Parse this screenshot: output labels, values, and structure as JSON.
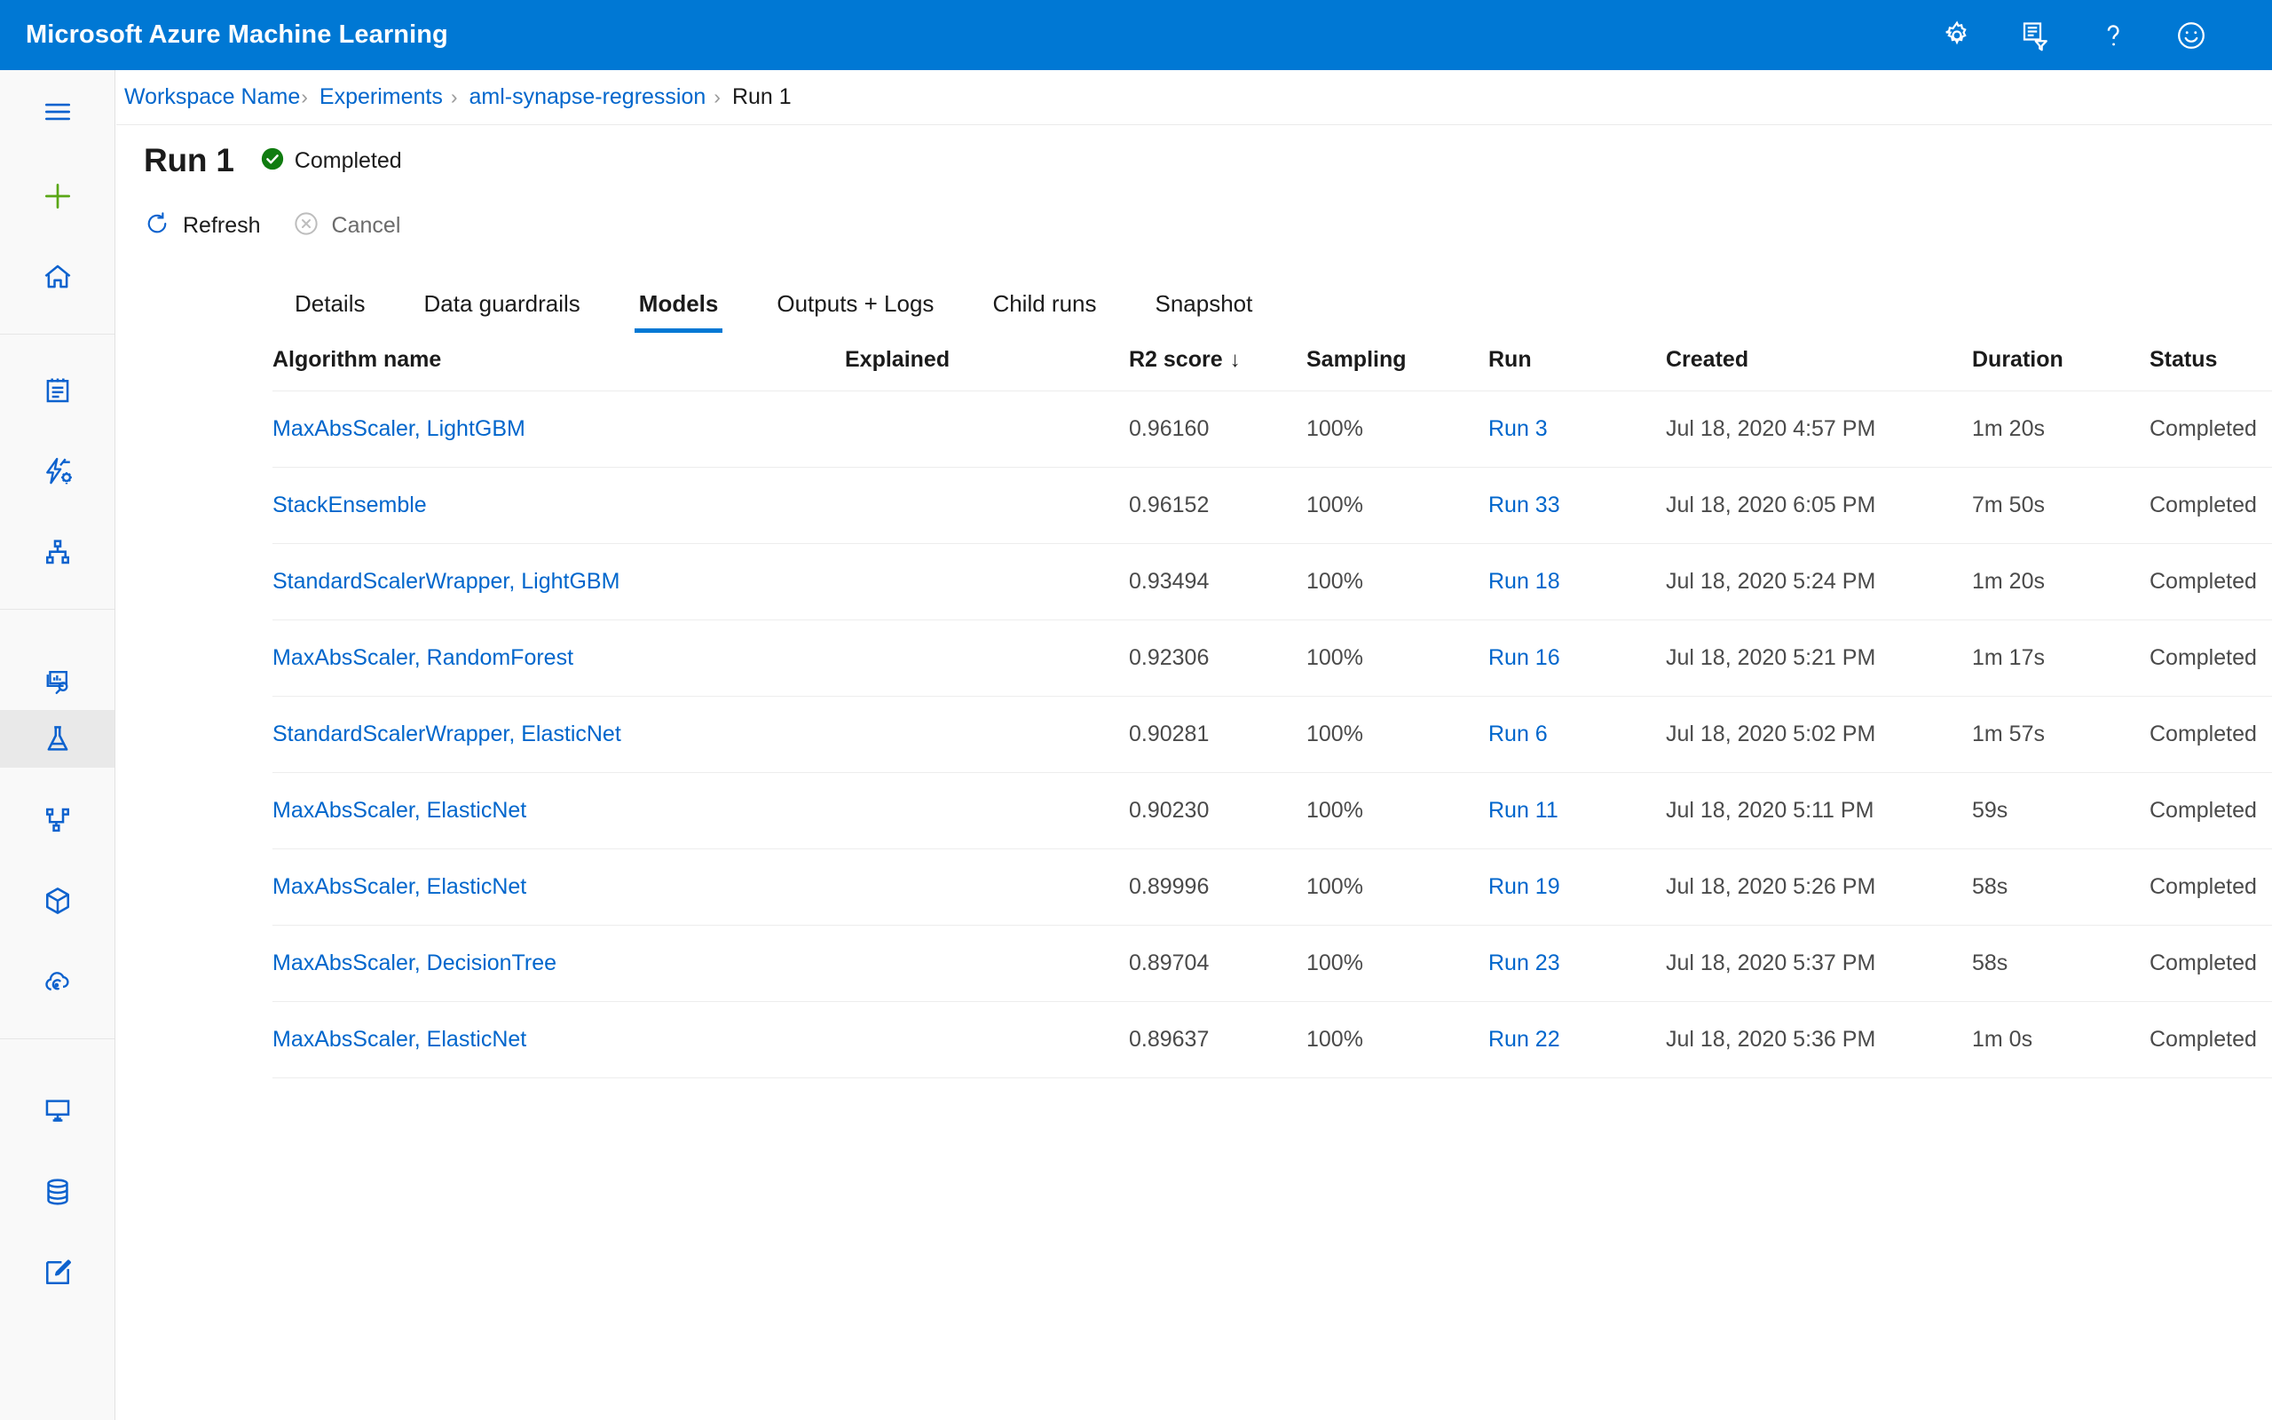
{
  "topbar": {
    "brand": "Microsoft Azure Machine Learning",
    "accent_color": "#0078d4",
    "icons": [
      {
        "name": "gear-icon",
        "label": "Settings"
      },
      {
        "name": "activity-log-icon",
        "label": "Activity log"
      },
      {
        "name": "help-icon",
        "label": "Help"
      },
      {
        "name": "feedback-smiley-icon",
        "label": "Feedback"
      }
    ]
  },
  "rail": {
    "items": [
      {
        "name": "hamburger-menu-icon",
        "label": "Menu",
        "active": false
      },
      {
        "name": "new-plus-icon",
        "label": "New",
        "active": false
      },
      {
        "name": "home-icon",
        "label": "Home",
        "active": false
      },
      {
        "name": "notebooks-icon",
        "label": "Notebooks",
        "active": false
      },
      {
        "name": "automated-ml-icon",
        "label": "Automated ML",
        "active": false
      },
      {
        "name": "designer-icon",
        "label": "Designer",
        "active": false
      },
      {
        "name": "datasets-explore-icon",
        "label": "Datasets",
        "active": false
      },
      {
        "name": "experiments-flask-icon",
        "label": "Experiments",
        "active": true
      },
      {
        "name": "pipelines-icon",
        "label": "Pipelines",
        "active": false
      },
      {
        "name": "models-cube-icon",
        "label": "Models",
        "active": false
      },
      {
        "name": "endpoints-cloud-icon",
        "label": "Endpoints",
        "active": false
      },
      {
        "name": "compute-monitor-icon",
        "label": "Compute",
        "active": false
      },
      {
        "name": "datastores-icon",
        "label": "Datastores",
        "active": false
      },
      {
        "name": "data-labeling-icon",
        "label": "Data labeling",
        "active": false
      }
    ]
  },
  "breadcrumb": {
    "items": [
      {
        "label": "Workspace Name",
        "current": false
      },
      {
        "label": "Experiments",
        "current": false
      },
      {
        "label": "aml-synapse-regression",
        "current": false
      },
      {
        "label": "Run 1",
        "current": true
      }
    ],
    "separator": "›"
  },
  "header": {
    "title": "Run 1",
    "status": "Completed",
    "status_color": "#107c10",
    "status_icon": "check-circle-icon"
  },
  "commands": {
    "refresh": {
      "label": "Refresh",
      "icon": "refresh-icon",
      "disabled": false
    },
    "cancel": {
      "label": "Cancel",
      "icon": "cancel-circle-icon",
      "disabled": true
    }
  },
  "tabs": {
    "items": [
      {
        "label": "Details",
        "active": false
      },
      {
        "label": "Data guardrails",
        "active": false
      },
      {
        "label": "Models",
        "active": true
      },
      {
        "label": "Outputs + Logs",
        "active": false
      },
      {
        "label": "Child runs",
        "active": false
      },
      {
        "label": "Snapshot",
        "active": false
      }
    ],
    "active_underline_color": "#0078d4"
  },
  "table": {
    "columns": [
      {
        "key": "algorithm",
        "label": "Algorithm name",
        "sort": null
      },
      {
        "key": "explained",
        "label": "Explained",
        "sort": null
      },
      {
        "key": "r2",
        "label": "R2 score",
        "sort": "desc",
        "sort_glyph": "↓"
      },
      {
        "key": "sampling",
        "label": "Sampling",
        "sort": null
      },
      {
        "key": "run",
        "label": "Run",
        "sort": null
      },
      {
        "key": "created",
        "label": "Created",
        "sort": null
      },
      {
        "key": "duration",
        "label": "Duration",
        "sort": null
      },
      {
        "key": "status",
        "label": "Status",
        "sort": null
      }
    ],
    "rows": [
      {
        "algorithm": "MaxAbsScaler, LightGBM",
        "explained": "",
        "r2": "0.96160",
        "sampling": "100%",
        "run": "Run 3",
        "created": "Jul 18, 2020 4:57 PM",
        "duration": "1m 20s",
        "status": "Completed"
      },
      {
        "algorithm": "StackEnsemble",
        "explained": "",
        "r2": "0.96152",
        "sampling": "100%",
        "run": "Run 33",
        "created": "Jul 18, 2020 6:05 PM",
        "duration": "7m 50s",
        "status": "Completed"
      },
      {
        "algorithm": "StandardScalerWrapper, LightGBM",
        "explained": "",
        "r2": "0.93494",
        "sampling": "100%",
        "run": "Run 18",
        "created": "Jul 18, 2020 5:24 PM",
        "duration": "1m 20s",
        "status": "Completed"
      },
      {
        "algorithm": "MaxAbsScaler, RandomForest",
        "explained": "",
        "r2": "0.92306",
        "sampling": "100%",
        "run": "Run 16",
        "created": "Jul 18, 2020 5:21 PM",
        "duration": "1m 17s",
        "status": "Completed"
      },
      {
        "algorithm": "StandardScalerWrapper, ElasticNet",
        "explained": "",
        "r2": "0.90281",
        "sampling": "100%",
        "run": "Run 6",
        "created": "Jul 18, 2020 5:02 PM",
        "duration": "1m 57s",
        "status": "Completed"
      },
      {
        "algorithm": "MaxAbsScaler, ElasticNet",
        "explained": "",
        "r2": "0.90230",
        "sampling": "100%",
        "run": "Run 11",
        "created": "Jul 18, 2020 5:11 PM",
        "duration": "59s",
        "status": "Completed"
      },
      {
        "algorithm": "MaxAbsScaler, ElasticNet",
        "explained": "",
        "r2": "0.89996",
        "sampling": "100%",
        "run": "Run 19",
        "created": "Jul 18, 2020 5:26 PM",
        "duration": "58s",
        "status": "Completed"
      },
      {
        "algorithm": "MaxAbsScaler, DecisionTree",
        "explained": "",
        "r2": "0.89704",
        "sampling": "100%",
        "run": "Run 23",
        "created": "Jul 18, 2020 5:37 PM",
        "duration": "58s",
        "status": "Completed"
      },
      {
        "algorithm": "MaxAbsScaler, ElasticNet",
        "explained": "",
        "r2": "0.89637",
        "sampling": "100%",
        "run": "Run 22",
        "created": "Jul 18, 2020 5:36 PM",
        "duration": "1m 0s",
        "status": "Completed"
      }
    ]
  },
  "scrollbar": {
    "up_glyph": "▲",
    "down_glyph": "▼"
  }
}
